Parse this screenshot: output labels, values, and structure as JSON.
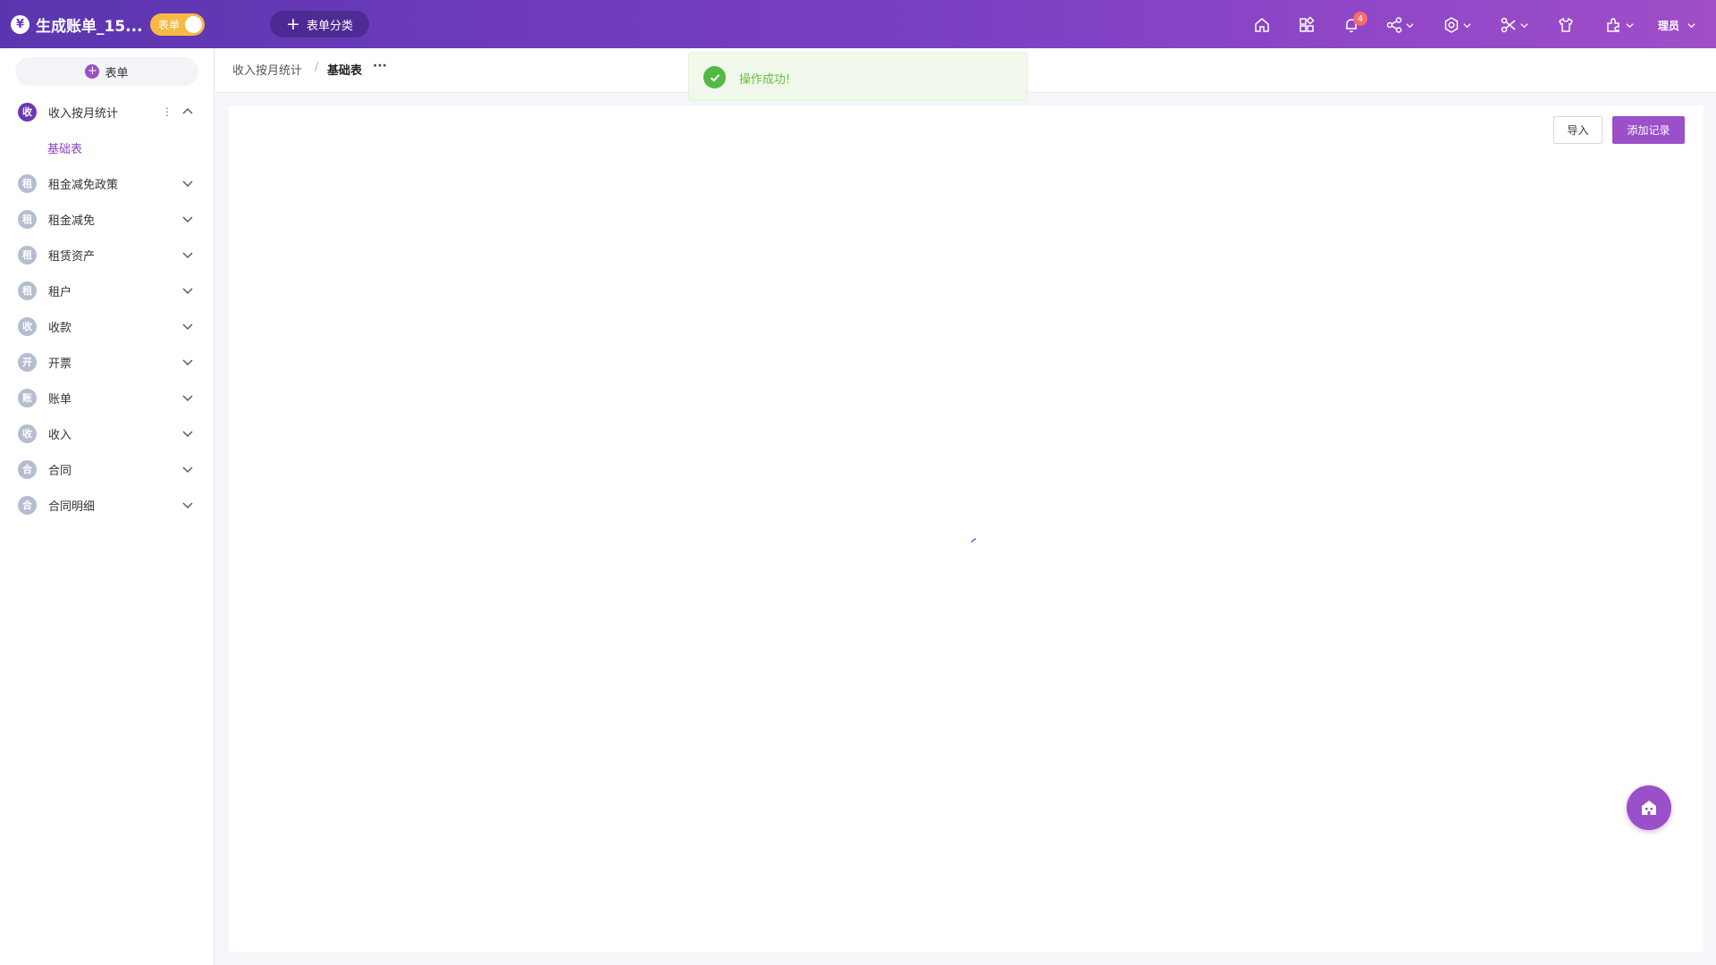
{
  "header": {
    "logo_glyph": "¥",
    "app_title": "生成账单_15...",
    "mode_toggle_label": "表单",
    "category_button_label": "表单分类",
    "notification_count": "4",
    "user_name": "理员",
    "icons": [
      "home-icon",
      "apps-grid-icon",
      "bell-icon",
      "share-icon",
      "settings-icon",
      "tools-icon",
      "shirt-icon",
      "plugin-icon"
    ]
  },
  "sidebar": {
    "add_form_label": "表单",
    "items": [
      {
        "badge": "收",
        "label": "收入按月统计",
        "expanded": true
      },
      {
        "badge": "租",
        "label": "租金减免政策"
      },
      {
        "badge": "租",
        "label": "租金减免"
      },
      {
        "badge": "租",
        "label": "租赁资产"
      },
      {
        "badge": "租",
        "label": "租户"
      },
      {
        "badge": "收",
        "label": "收款"
      },
      {
        "badge": "开",
        "label": "开票"
      },
      {
        "badge": "账",
        "label": "账单"
      },
      {
        "badge": "收",
        "label": "收入"
      },
      {
        "badge": "合",
        "label": "合同"
      },
      {
        "badge": "合",
        "label": "合同明细"
      }
    ],
    "sub_item": "基础表",
    "more_glyph": "⋮"
  },
  "breadcrumb": {
    "parent": "收入按月统计",
    "separator": "/",
    "current": "基础表",
    "more": "···"
  },
  "toolbar": {
    "import_label": "导入",
    "add_record_label": "添加记录"
  },
  "toast": {
    "message": "操作成功!",
    "type": "success"
  },
  "colors": {
    "header_gradient_start": "#5b35b0",
    "header_gradient_end": "#a04ec9",
    "accent": "#9b4fc9",
    "toggle": "#f5b944",
    "success": "#67c23a"
  }
}
